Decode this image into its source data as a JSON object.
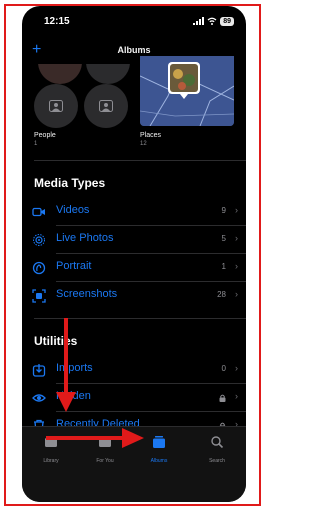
{
  "status_bar": {
    "time": "12:15",
    "battery": "89"
  },
  "nav": {
    "title": "Albums",
    "add_label": "+"
  },
  "people_places": {
    "people": {
      "label": "People",
      "count": "1"
    },
    "places": {
      "label": "Places",
      "count": "12"
    }
  },
  "media_types": {
    "title": "Media Types",
    "items": [
      {
        "label": "Videos",
        "count": "9",
        "icon": "video-icon"
      },
      {
        "label": "Live Photos",
        "count": "5",
        "icon": "live-photo-icon"
      },
      {
        "label": "Portrait",
        "count": "1",
        "icon": "portrait-icon"
      },
      {
        "label": "Screenshots",
        "count": "28",
        "icon": "screenshot-icon"
      }
    ]
  },
  "utilities": {
    "title": "Utilities",
    "items": [
      {
        "label": "Imports",
        "count": "0",
        "icon": "import-icon"
      },
      {
        "label": "Hidden",
        "count": "",
        "icon": "eye-icon",
        "locked": true
      },
      {
        "label": "Recently Deleted",
        "count": "",
        "icon": "trash-icon",
        "locked": true
      }
    ]
  },
  "tabbar": {
    "tabs": [
      {
        "label": "Library",
        "active": false
      },
      {
        "label": "For You",
        "active": false
      },
      {
        "label": "Albums",
        "active": true
      },
      {
        "label": "Search",
        "active": false
      }
    ]
  },
  "colors": {
    "accent": "#1b78f2",
    "annotation": "#e01a1a",
    "background": "#000000"
  }
}
